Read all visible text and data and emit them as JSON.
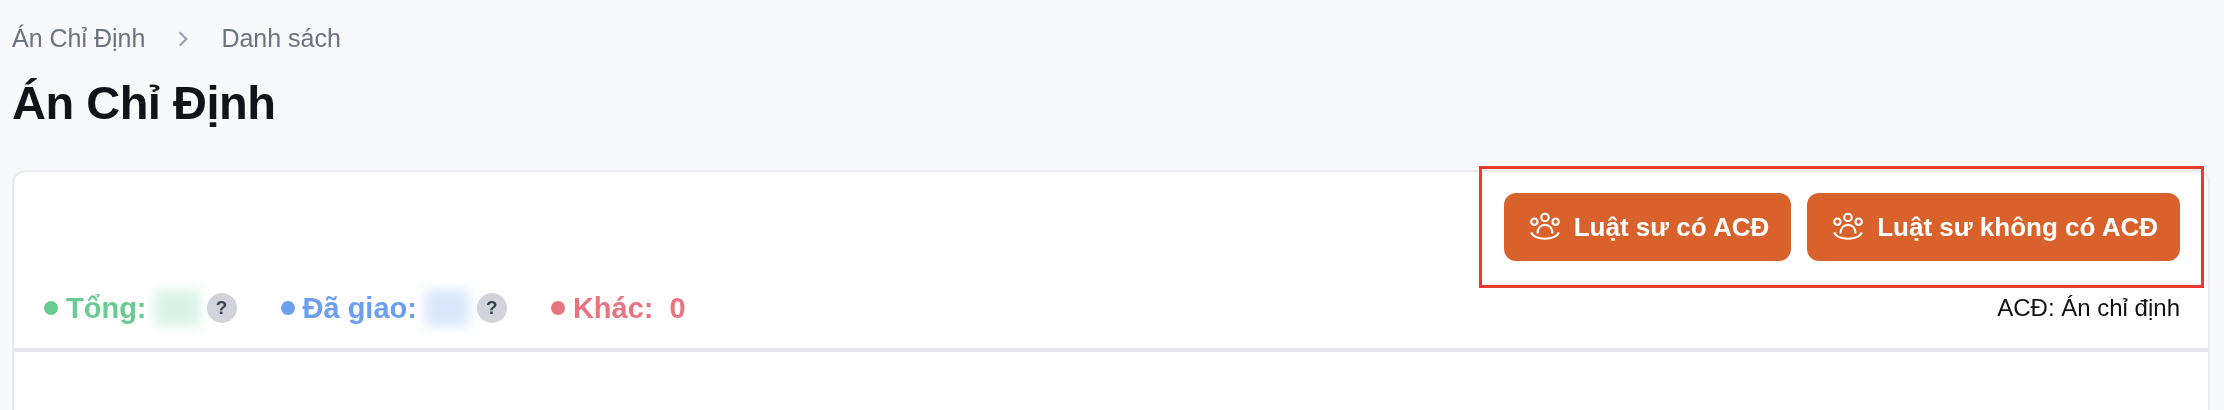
{
  "breadcrumb": [
    {
      "label": "Án Chỉ Định"
    },
    {
      "label": "Danh sách"
    }
  ],
  "title": "Án Chỉ Định",
  "buttons": [
    {
      "label": "Luật sư có ACĐ"
    },
    {
      "label": "Luật sư không có ACĐ"
    }
  ],
  "stats": [
    {
      "label": "Tổng:",
      "color": "#6acb92",
      "kind": "hidden",
      "help": "?"
    },
    {
      "label": "Đã giao:",
      "color": "#6d9ff0",
      "kind": "hidden",
      "help": "?"
    },
    {
      "label": "Khác:",
      "color": "#e87482",
      "kind": "value",
      "value": "0"
    }
  ],
  "legend": "ACĐ: Án chỉ định"
}
